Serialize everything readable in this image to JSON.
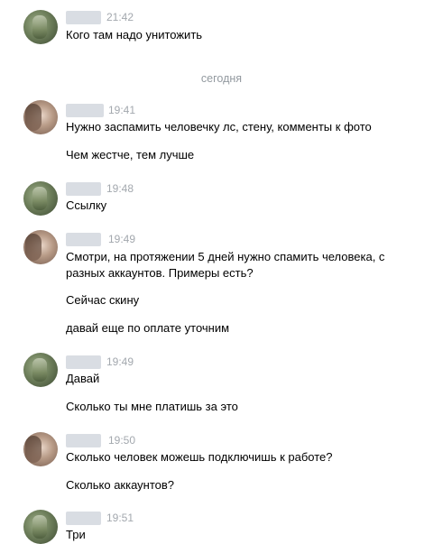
{
  "divider": "сегодня",
  "messages": [
    {
      "avatar": "a1",
      "time": "21:42",
      "lines": [
        "Кого там надо унитожить"
      ]
    },
    {
      "avatar": "a2",
      "time": "19:41",
      "lines": [
        "Нужно заспамить человечку лс, стену, комменты к фото",
        "Чем жестче, тем лучше"
      ]
    },
    {
      "avatar": "a1",
      "time": "19:48",
      "lines": [
        "Ссылку"
      ]
    },
    {
      "avatar": "a2",
      "time": "19:49",
      "lines": [
        "Смотри, на протяжении 5 дней нужно спамить человека, с разных аккаунтов. Примеры есть?",
        "Сейчас скину",
        "давай еще по оплате уточним"
      ]
    },
    {
      "avatar": "a1",
      "time": "19:49",
      "lines": [
        "Давай",
        "Сколько ты мне платишь за это"
      ]
    },
    {
      "avatar": "a2",
      "time": "19:50",
      "lines": [
        "Сколько человек можешь подключишь к работе?",
        "Сколько аккаунтов?"
      ]
    },
    {
      "avatar": "a1",
      "time": "19:51",
      "lines": [
        "Три"
      ]
    }
  ]
}
